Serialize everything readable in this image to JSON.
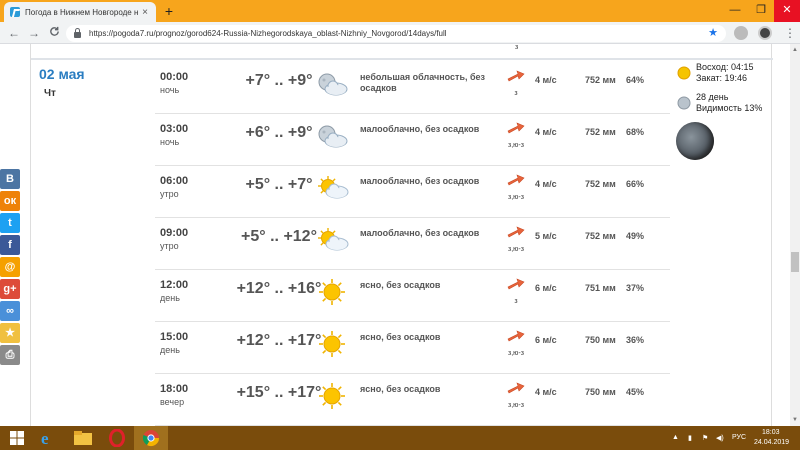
{
  "browser": {
    "tab_title": "Погода в Нижнем Новгороде н",
    "tab_close": "×",
    "new_tab": "+",
    "win_minimize": "—",
    "win_maximize": "❐",
    "win_close": "✕",
    "back": "←",
    "forward": "→",
    "reload": "C",
    "url": "https://pogoda7.ru/prognoz/gorod624-Russia-Nizhegorodskaya_oblast-Nizhniy_Novgorod/14days/full",
    "bookmark_star": "★",
    "menu": "⋮"
  },
  "prev_row_direction": "з",
  "day": {
    "date": "02 мая",
    "weekday": "Чт"
  },
  "rows": [
    {
      "time": "00:00",
      "period": "ночь",
      "temp": "+7° .. +9°",
      "icon": "moon-cloud-icon",
      "desc": "небольшая облачность, без осадков",
      "wind_dir": "з",
      "wind_speed": "4 м/с",
      "pressure": "752 мм",
      "humidity": "64%"
    },
    {
      "time": "03:00",
      "period": "ночь",
      "temp": "+6° .. +9°",
      "icon": "moon-cloud-icon",
      "desc": "малооблачно, без осадков",
      "wind_dir": "з,ю-з",
      "wind_speed": "4 м/с",
      "pressure": "752 мм",
      "humidity": "68%"
    },
    {
      "time": "06:00",
      "period": "утро",
      "temp": "+5° .. +7°",
      "icon": "sun-cloud-icon",
      "desc": "малооблачно, без осадков",
      "wind_dir": "з,ю-з",
      "wind_speed": "4 м/с",
      "pressure": "752 мм",
      "humidity": "66%"
    },
    {
      "time": "09:00",
      "period": "утро",
      "temp": "+5° .. +12°",
      "icon": "sun-cloud-icon",
      "desc": "малооблачно, без осадков",
      "wind_dir": "з,ю-з",
      "wind_speed": "5 м/с",
      "pressure": "752 мм",
      "humidity": "49%"
    },
    {
      "time": "12:00",
      "period": "день",
      "temp": "+12° .. +16°",
      "icon": "sun-icon",
      "desc": "ясно, без осадков",
      "wind_dir": "з",
      "wind_speed": "6 м/с",
      "pressure": "751 мм",
      "humidity": "37%"
    },
    {
      "time": "15:00",
      "period": "день",
      "temp": "+12° .. +17°",
      "icon": "sun-icon",
      "desc": "ясно, без осадков",
      "wind_dir": "з,ю-з",
      "wind_speed": "6 м/с",
      "pressure": "750 мм",
      "humidity": "36%"
    },
    {
      "time": "18:00",
      "period": "вечер",
      "temp": "+15° .. +17°",
      "icon": "sun-icon",
      "desc": "ясно, без осадков",
      "wind_dir": "з,ю-з",
      "wind_speed": "4 м/с",
      "pressure": "750 мм",
      "humidity": "45%"
    }
  ],
  "astro": {
    "sunrise": "Восход: 04:15",
    "sunset": "Закат: 19:46",
    "moon_day": "28 день",
    "moon_visibility": "Видимость 13%"
  },
  "social": [
    {
      "name": "vk-icon",
      "glyph": "В",
      "color": "#4c75a3"
    },
    {
      "name": "odnoklassniki-icon",
      "glyph": "ок",
      "color": "#ee8208"
    },
    {
      "name": "twitter-icon",
      "glyph": "t",
      "color": "#1da1f2"
    },
    {
      "name": "facebook-icon",
      "glyph": "f",
      "color": "#3b5998"
    },
    {
      "name": "mailru-icon",
      "glyph": "@",
      "color": "#f5a000"
    },
    {
      "name": "google-plus-icon",
      "glyph": "g+",
      "color": "#dd4b39"
    },
    {
      "name": "share-icon",
      "glyph": "∞",
      "color": "#4a90d9"
    },
    {
      "name": "favorite-icon",
      "glyph": "★",
      "color": "#f0c040"
    },
    {
      "name": "print-icon",
      "glyph": "⎙",
      "color": "#8a8a8a"
    }
  ],
  "taskbar": {
    "language": "РУС",
    "time": "18:03",
    "date": "24.04.2019"
  }
}
